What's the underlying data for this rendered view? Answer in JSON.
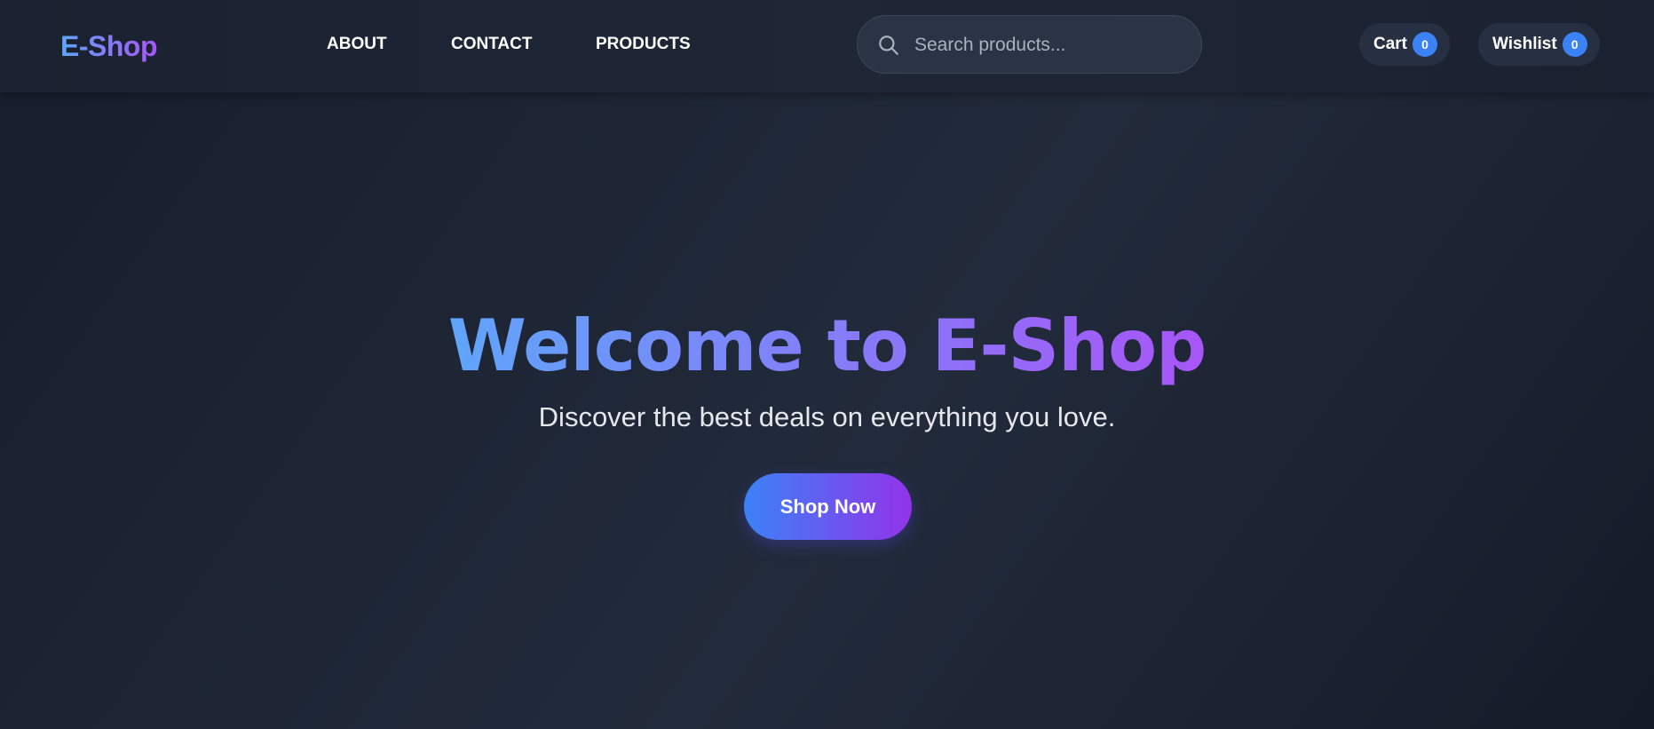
{
  "header": {
    "logo": "E-Shop",
    "nav": [
      {
        "label": "ABOUT"
      },
      {
        "label": "CONTACT"
      },
      {
        "label": "PRODUCTS"
      }
    ],
    "search": {
      "placeholder": "Search products...",
      "value": ""
    },
    "cart": {
      "label": "Cart",
      "count": "0"
    },
    "wishlist": {
      "label": "Wishlist",
      "count": "0"
    }
  },
  "hero": {
    "title": "Welcome to E-Shop",
    "subtitle": "Discover the best deals on everything you love.",
    "cta_label": "Shop Now"
  },
  "theme": {
    "gradient_start": "#60a5fa",
    "gradient_end": "#a855f7",
    "badge_color": "#3b82f6",
    "background": "#1d2535"
  },
  "icons": {
    "search": "search-icon"
  }
}
